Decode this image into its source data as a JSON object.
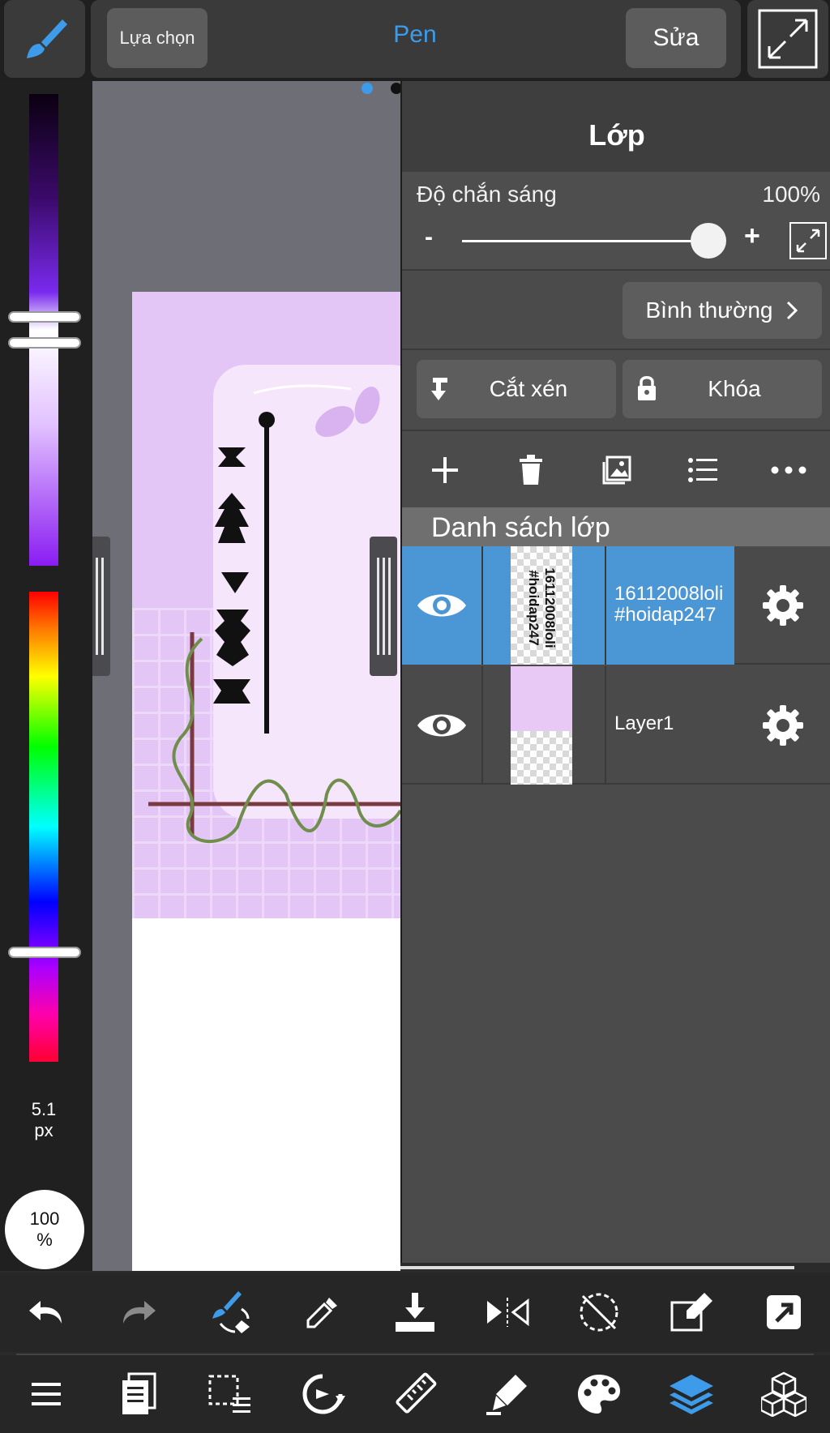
{
  "topbar": {
    "selection_label": "Lựa chọn",
    "tool_title": "Pen",
    "edit_label": "Sửa"
  },
  "left_panel": {
    "brush_size_value": "5.1",
    "brush_size_unit": "px",
    "opacity_value": "100",
    "opacity_unit": "%"
  },
  "layers_panel": {
    "title": "Lớp",
    "opacity_label": "Độ chắn sáng",
    "opacity_value": "100%",
    "opacity_fraction": 1.0,
    "minus_label": "-",
    "plus_label": "+",
    "blend_mode": "Bình thường",
    "clipping_label": "Cắt xén",
    "lock_label": "Khóa",
    "list_header": "Danh sách lớp",
    "layers": [
      {
        "name": "16112008loli\n#hoidap247",
        "name_line1": "16112008loli",
        "name_line2": "#hoidap247",
        "thumb_text": "16112008loli #hoidap247",
        "selected": true,
        "visible": true
      },
      {
        "name": "Layer1",
        "selected": false,
        "visible": true
      }
    ]
  },
  "colors": {
    "accent": "#3d9be9",
    "selected_layer": "#4b97d6",
    "panel_bg": "#4b4b4b",
    "toolbar_bg": "#262626"
  }
}
